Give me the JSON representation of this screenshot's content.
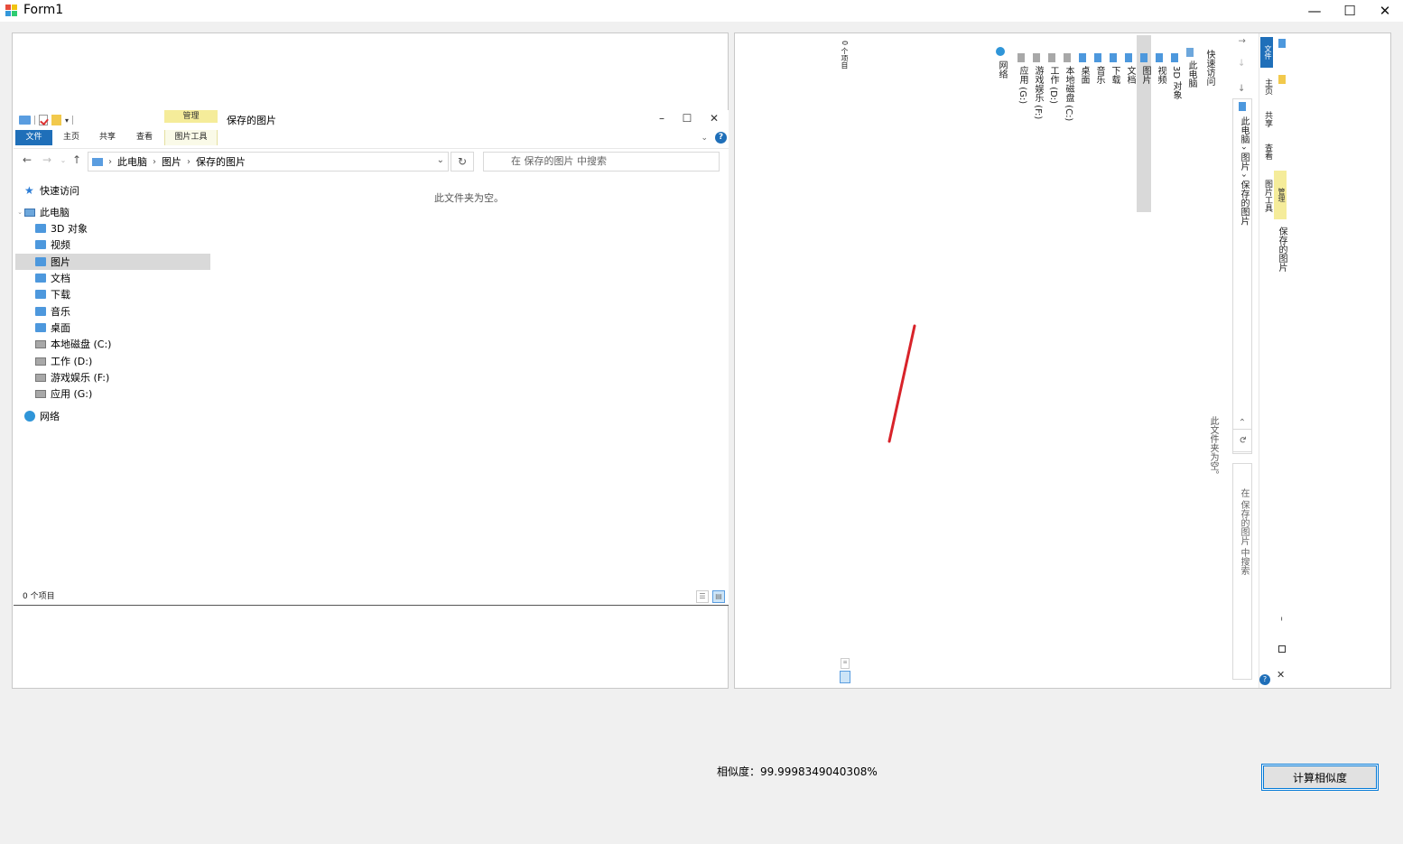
{
  "window": {
    "title": "Form1",
    "controls": {
      "minimize": "—",
      "maximize": "☐",
      "close": "✕"
    }
  },
  "explorer": {
    "title": "保存的图片",
    "manage_label": "管理",
    "tabs": [
      "文件",
      "主页",
      "共享",
      "查看",
      "图片工具"
    ],
    "breadcrumb": [
      "此电脑",
      "图片",
      "保存的图片"
    ],
    "search_placeholder": "在 保存的图片 中搜索",
    "nav_items": [
      {
        "label": "快速访问",
        "icon": "star-icon"
      },
      {
        "label": "此电脑",
        "icon": "pc-icon"
      },
      {
        "label": "3D 对象",
        "icon": "folder-icon"
      },
      {
        "label": "视频",
        "icon": "folder-icon"
      },
      {
        "label": "图片",
        "icon": "folder-icon",
        "selected": true
      },
      {
        "label": "文档",
        "icon": "folder-icon"
      },
      {
        "label": "下载",
        "icon": "folder-icon"
      },
      {
        "label": "音乐",
        "icon": "folder-icon"
      },
      {
        "label": "桌面",
        "icon": "folder-icon"
      },
      {
        "label": "本地磁盘 (C:)",
        "icon": "drive-icon"
      },
      {
        "label": "工作 (D:)",
        "icon": "drive-icon"
      },
      {
        "label": "游戏娱乐 (F:)",
        "icon": "drive-icon"
      },
      {
        "label": "应用 (G:)",
        "icon": "drive-icon"
      },
      {
        "label": "网络",
        "icon": "network-icon"
      }
    ],
    "empty_message": "此文件夹为空。",
    "status": "0 个项目"
  },
  "rotated_explorer": {
    "title": "保存的图片",
    "manage_label": "管理",
    "tabs": [
      "文件",
      "主页",
      "共享",
      "查看",
      "图片工具"
    ],
    "breadcrumb": "此电脑 › 图片 › 保存的图片",
    "search_placeholder": "在 保存的图片 中搜索",
    "nav_items": [
      "快速访问",
      "此电脑",
      "3D 对象",
      "视频",
      "图片",
      "文档",
      "下载",
      "音乐",
      "桌面",
      "本地磁盘 (C:)",
      "工作 (D:)",
      "游戏娱乐 (F:)",
      "应用 (G:)",
      "网络"
    ],
    "empty_message": "此文件夹为空。",
    "status": "0 个项目"
  },
  "result": {
    "similarity_text": "相似度：99.9998349040308%"
  },
  "buttons": {
    "calculate": "计算相似度"
  },
  "colors": {
    "accent": "#1f6fb9",
    "manage_bg": "#f5ec9a",
    "selection": "#d9d9d9",
    "red_mark": "#d8232a"
  }
}
